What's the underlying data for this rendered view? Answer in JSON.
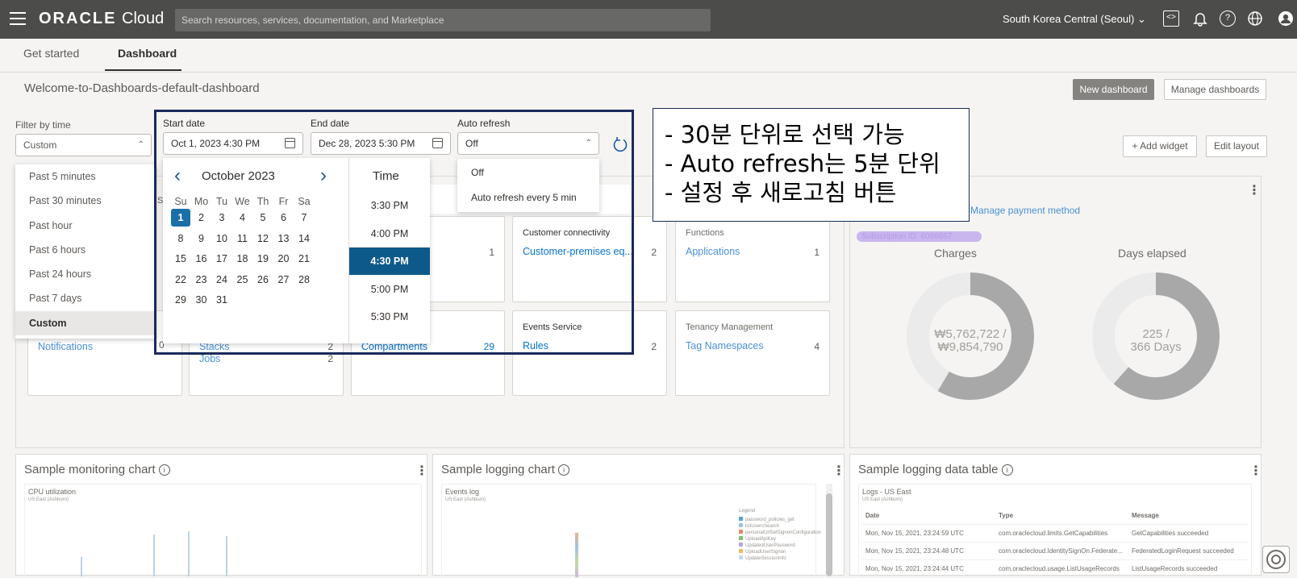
{
  "topbar": {
    "brand_bold": "ORACLE",
    "brand_light": "Cloud",
    "search_placeholder": "Search resources, services, documentation, and Marketplace",
    "region": "South Korea Central (Seoul)",
    "help_glyph": "?"
  },
  "tabs": [
    {
      "label": "Get started"
    },
    {
      "label": "Dashboard"
    }
  ],
  "dashboard": {
    "title": "Welcome-to-Dashboards-default-dashboard",
    "new_button": "New dashboard",
    "manage_button": "Manage dashboards",
    "add_widget": "+ Add widget",
    "edit_layout": "Edit layout"
  },
  "filter": {
    "label": "Filter by time",
    "value": "Custom",
    "options": [
      "Past 5 minutes",
      "Past 30 minutes",
      "Past hour",
      "Past 6 hours",
      "Past 24 hours",
      "Past 7 days",
      "Custom"
    ],
    "selected_index": 6
  },
  "start_date": {
    "label": "Start date",
    "value": "Oct 1, 2023 4:30 PM"
  },
  "end_date": {
    "label": "End date",
    "value": "Dec 28, 2023 5:30 PM"
  },
  "auto_refresh": {
    "label": "Auto refresh",
    "value": "Off",
    "options": [
      "Off",
      "Auto refresh every 5 min"
    ]
  },
  "calendar": {
    "month": "October 2023",
    "weekdays": [
      "Su",
      "Mo",
      "Tu",
      "We",
      "Th",
      "Fr",
      "Sa"
    ],
    "selected_day": 1,
    "days_in_month": 31,
    "first_weekday": 0
  },
  "time_picker": {
    "header": "Time",
    "times": [
      "3:30 PM",
      "4:00 PM",
      "4:30 PM",
      "5:00 PM",
      "5:30 PM"
    ],
    "selected_index": 2
  },
  "annotation": {
    "lines": [
      "- 30분 단위로 선택 가능",
      "- Auto refresh는 5분 단위",
      "- 설정 후 새로고침 버튼"
    ]
  },
  "cards": [
    {
      "title": "Customer connectivity",
      "link": "Customer-premises eq...",
      "count": "2"
    },
    {
      "title": "Functions",
      "link": "Applications",
      "count": "1"
    },
    {
      "title": "Events Service",
      "link": "Rules",
      "count": "2"
    },
    {
      "title": "Tenancy Management",
      "link": "Tag Namespaces",
      "count": "4"
    }
  ],
  "partial_cards": {
    "count_a": "1",
    "notifications": "Notifications",
    "notif_count": "0",
    "stacks": "Stacks",
    "stacks_count": "2",
    "jobs": "Jobs",
    "jobs_count": "2",
    "compartments": "Compartments",
    "compartments_count": "29",
    "se_fragment": "Se"
  },
  "billing": {
    "manage_payment": "Manage payment method",
    "subscription_redacted": "Subscription ID: 6066667",
    "charges_label": "Charges",
    "charges_value": "₩5,762,722 /",
    "charges_total": "₩9,854,790",
    "charges_fraction": 0.585,
    "days_label": "Days elapsed",
    "days_value": "225 /",
    "days_total": "366 Days",
    "days_fraction": 0.615
  },
  "bottom": {
    "monitoring_title": "Sample monitoring chart",
    "monitoring_sub": "CPU utilization",
    "monitoring_region": "US East (Ashburn)",
    "logging_title": "Sample logging chart",
    "logging_sub": "Events log",
    "logging_region": "US East (Ashburn)",
    "table_title": "Sample logging data table",
    "table_sub": "Logs - US East",
    "table_region": "US East (Ashburn)",
    "table_headers": [
      "Date",
      "Type",
      "Message"
    ],
    "table_rows": [
      [
        "Mon, Nov 15, 2021, 23:24:59 UTC",
        "com.oraclecloud.limits.GetCapabilities",
        "GetCapabilities succeeded"
      ],
      [
        "Mon, Nov 15, 2021, 23:24:48 UTC",
        "com.oraclecloud.IdentitySignOn.Federate...",
        "FederatedLoginRequest succeeded"
      ],
      [
        "Mon, Nov 15, 2021, 23:24:44 UTC",
        "com.oraclecloud.usage.ListUsageRecords",
        "ListUsageRecords succeeded"
      ]
    ],
    "legend_title": "Legend",
    "legend_items": [
      "password_policies_get",
      "listUsersSearch",
      "personalUrlSetSignonConfiguration",
      "UploadApiKey",
      "UpdatedUserPassword",
      "UploadUserSignon",
      "UpdateSessionInfo"
    ]
  },
  "colors": {
    "topbar": "#4c4c4b",
    "accent_link": "#0572ce",
    "selected_day": "#1a6fa8",
    "selected_time": "#0d5a8a",
    "donut_fill": "#a8a8a8",
    "donut_track": "#ebebeb"
  }
}
